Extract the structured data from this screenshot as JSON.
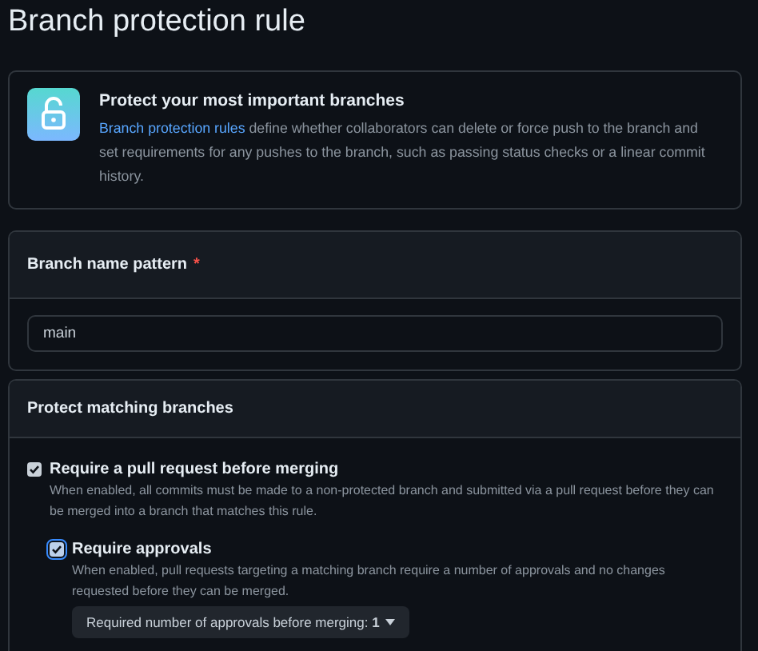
{
  "page_title": "Branch protection rule",
  "intro": {
    "heading": "Protect your most important branches",
    "link": "Branch protection rules",
    "text": " define whether collaborators can delete or force push to the branch and set requirements for any pushes to the branch, such as passing status checks or a linear commit history."
  },
  "pattern": {
    "label": "Branch name pattern",
    "required_mark": "*",
    "value": "main"
  },
  "protect": {
    "heading": "Protect matching branches",
    "options": [
      {
        "label": "Require a pull request before merging",
        "checked": true,
        "description": "When enabled, all commits must be made to a non-protected branch and submitted via a pull request before they can be merged into a branch that matches this rule.",
        "children": [
          {
            "label": "Require approvals",
            "checked": true,
            "description": "When enabled, pull requests targeting a matching branch require a number of approvals and no changes requested before they can be merged.",
            "dropdown": "Required number of approvals before merging: **1**"
          }
        ]
      }
    ]
  }
}
